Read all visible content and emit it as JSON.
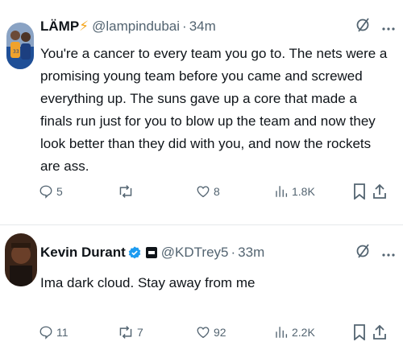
{
  "tweets": [
    {
      "display_name": "LÄMP",
      "emoji": "⚡",
      "handle": "@lampindubai",
      "separator": "·",
      "time": "34m",
      "text": "You're a cancer to every team you go to. The nets were a promising young team before you came and screwed everything up. The suns gave up a core that made a finals run just for you to blow up the team and now they look better than they did with you, and now the rockets are ass.",
      "replies": "5",
      "reposts": "",
      "likes": "8",
      "views": "1.8K"
    },
    {
      "display_name": "Kevin Durant",
      "verified": true,
      "handle": "@KDTrey5",
      "separator": "·",
      "time": "33m",
      "text": "Ima dark cloud. Stay away from me",
      "replies": "11",
      "reposts": "7",
      "likes": "92",
      "views": "2.2K"
    }
  ],
  "icons": {
    "reply": "reply-icon",
    "repost": "repost-icon",
    "like": "like-icon",
    "views": "views-icon",
    "bookmark": "bookmark-icon",
    "share": "share-icon",
    "grok": "grok-icon",
    "more": "more-icon"
  },
  "colors": {
    "text": "#0f1419",
    "secondary": "#536471",
    "verified": "#1d9bf0",
    "bolt": "#f4a51c"
  }
}
